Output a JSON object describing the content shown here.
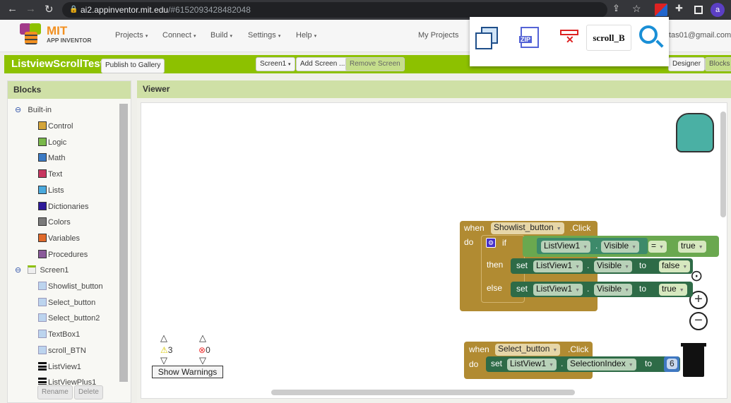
{
  "browser": {
    "url_host": "ai2.appinventor.mit.edu",
    "url_path": "/#6152093428482048",
    "avatar": "a"
  },
  "header": {
    "logo_top": "MIT",
    "logo_bottom": "APP INVENTOR",
    "menus": [
      "Projects",
      "Connect",
      "Build",
      "Settings",
      "Help"
    ],
    "my_projects": "My Projects",
    "account": "tas01@gmail.com"
  },
  "project": {
    "name": "ListviewScrollTest",
    "publish": "Publish to Gallery",
    "screen": "Screen1",
    "add_screen": "Add Screen ...",
    "remove_screen": "Remove Screen",
    "designer": "Designer",
    "blocks": "Blocks"
  },
  "popup": {
    "search_value": "scroll_B",
    "zip_label": "ZIP"
  },
  "blocks_panel": {
    "title": "Blocks",
    "builtin": "Built-in",
    "builtin_items": [
      {
        "label": "Control",
        "color": "#d4a53b"
      },
      {
        "label": "Logic",
        "color": "#79b84a"
      },
      {
        "label": "Math",
        "color": "#3b7ac4"
      },
      {
        "label": "Text",
        "color": "#c7365f"
      },
      {
        "label": "Lists",
        "color": "#4aa9dd"
      },
      {
        "label": "Dictionaries",
        "color": "#2d1a99"
      },
      {
        "label": "Colors",
        "color": "#7a7a7a"
      },
      {
        "label": "Variables",
        "color": "#e06a2b"
      },
      {
        "label": "Procedures",
        "color": "#8a5a9a"
      }
    ],
    "screen": "Screen1",
    "components": [
      "Showlist_button",
      "Select_button",
      "Select_button2",
      "TextBox1",
      "scroll_BTN",
      "ListView1",
      "ListViewPlus1"
    ],
    "rename": "Rename",
    "delete": "Delete"
  },
  "viewer": {
    "title": "Viewer",
    "warnings_count": "3",
    "errors_count": "0",
    "show_warnings": "Show Warnings"
  },
  "block1": {
    "when": "when",
    "component": "Showlist_button",
    "event": ".Click",
    "do": "do",
    "if": "if",
    "then": "then",
    "else": "else",
    "cond_comp": "ListView1",
    "cond_prop": "Visible",
    "op": "=",
    "cond_val": "true",
    "set": "set",
    "to": "to",
    "then_comp": "ListView1",
    "then_prop": "Visible",
    "then_val": "false",
    "else_comp": "ListView1",
    "else_prop": "Visible",
    "else_val": "true"
  },
  "block2": {
    "when": "when",
    "component": "Select_button",
    "event": ".Click",
    "do": "do",
    "set": "set",
    "comp": "ListView1",
    "prop": "SelectionIndex",
    "to": "to",
    "value": "6"
  }
}
